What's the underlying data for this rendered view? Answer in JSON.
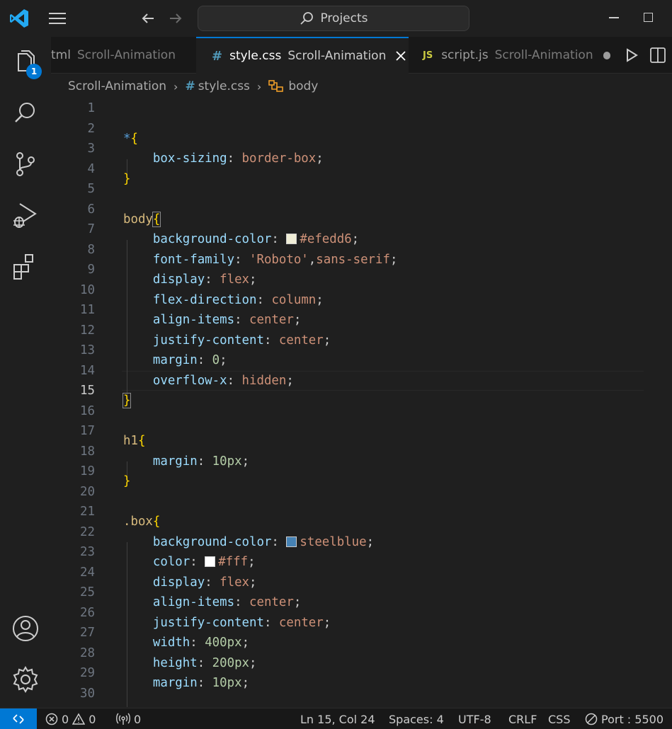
{
  "titlebar": {
    "search_text": "Projects"
  },
  "activity": {
    "explorer_badge": "1"
  },
  "tabs": [
    {
      "name": "tml",
      "dir": "Scroll-Animation"
    },
    {
      "name": "style.css",
      "dir": "Scroll-Animation",
      "icon": "#"
    },
    {
      "name": "script.js",
      "dir": "Scroll-Animation",
      "icon": "JS"
    }
  ],
  "breadcrumb": {
    "folder": "Scroll-Animation",
    "file": "style.css",
    "symbol": "body"
  },
  "editor": {
    "current_line": 15,
    "lines": [
      {
        "n": "1"
      },
      {
        "n": "2"
      },
      {
        "n": "3"
      },
      {
        "n": "4"
      },
      {
        "n": "5"
      },
      {
        "n": "6"
      },
      {
        "n": "7"
      },
      {
        "n": "8"
      },
      {
        "n": "9"
      },
      {
        "n": "10"
      },
      {
        "n": "11"
      },
      {
        "n": "12"
      },
      {
        "n": "13"
      },
      {
        "n": "14"
      },
      {
        "n": "15"
      },
      {
        "n": "16"
      },
      {
        "n": "17"
      },
      {
        "n": "18"
      },
      {
        "n": "19"
      },
      {
        "n": "20"
      },
      {
        "n": "21"
      },
      {
        "n": "22"
      },
      {
        "n": "23"
      },
      {
        "n": "24"
      },
      {
        "n": "25"
      },
      {
        "n": "26"
      },
      {
        "n": "27"
      },
      {
        "n": "28"
      },
      {
        "n": "29"
      },
      {
        "n": "30"
      }
    ],
    "code": {
      "l3_star": "*",
      "l4_prop": "box-sizing",
      "l4_val": "border-box",
      "l7_sel": "body",
      "l8_prop": "background-color",
      "l8_val": "#efedd6",
      "l9_prop": "font-family",
      "l9_val1": "'Roboto'",
      "l9_val2": "sans-serif",
      "l10_prop": "display",
      "l10_val": "flex",
      "l11_prop": "flex-direction",
      "l11_val": "column",
      "l12_prop": "align-items",
      "l12_val": "center",
      "l13_prop": "justify-content",
      "l13_val": "center",
      "l14_prop": "margin",
      "l14_val": "0",
      "l15_prop": "overflow-x",
      "l15_val": "hidden",
      "l18_sel": "h1",
      "l19_prop": "margin",
      "l19_val": "10px",
      "l22_sel": ".box",
      "l23_prop": "background-color",
      "l23_val": "steelblue",
      "l24_prop": "color",
      "l24_val": "#fff",
      "l25_prop": "display",
      "l25_val": "flex",
      "l26_prop": "align-items",
      "l26_val": "center",
      "l27_prop": "justify-content",
      "l27_val": "center",
      "l28_prop": "width",
      "l28_val": "400px",
      "l29_prop": "height",
      "l29_val": "200px",
      "l30_prop": "margin",
      "l30_val": "10px"
    },
    "swatches": {
      "efedd6": "#efedd6",
      "steelblue": "#4682b4",
      "fff": "#ffffff"
    }
  },
  "statusbar": {
    "errors": "0",
    "warnings": "0",
    "ports": "0",
    "cursor": "Ln 15, Col 24",
    "spaces": "Spaces: 4",
    "encoding": "UTF-8",
    "eol": "CRLF",
    "language": "CSS",
    "port": "Port : 5500"
  },
  "colors": {
    "accent": "#0078d4",
    "bg": "#1f1f1f"
  }
}
